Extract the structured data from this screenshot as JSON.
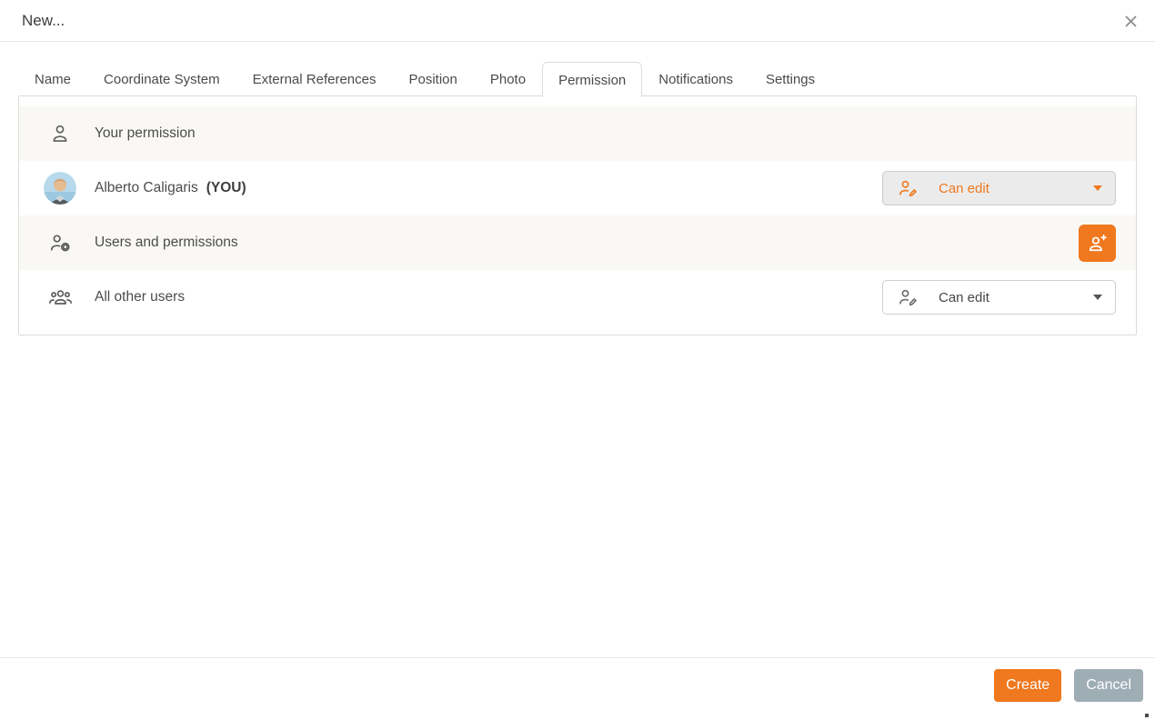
{
  "window": {
    "title": "New...",
    "close_icon": "x-icon"
  },
  "tabs": [
    {
      "label": "Name"
    },
    {
      "label": "Coordinate System"
    },
    {
      "label": "External References"
    },
    {
      "label": "Position"
    },
    {
      "label": "Photo"
    },
    {
      "label": "Permission",
      "active": true
    },
    {
      "label": "Notifications"
    },
    {
      "label": "Settings"
    }
  ],
  "permission_panel": {
    "your_permission_header": {
      "label": "Your permission",
      "icon": "person-icon"
    },
    "current_user": {
      "name": "Alberto Caligaris",
      "you_tag": "(YOU)",
      "avatar": "user-photo-avatar",
      "permission": {
        "label": "Can edit",
        "icon": "edit-user-icon",
        "state": "selected"
      }
    },
    "users_permissions_header": {
      "label": "Users and permissions",
      "icon": "users-gear-icon",
      "action_icon": "add-user-icon"
    },
    "all_other_users": {
      "label": "All other users",
      "icon": "group-icon",
      "permission": {
        "label": "Can edit",
        "icon": "edit-user-icon",
        "state": "default"
      }
    }
  },
  "footer": {
    "create_label": "Create",
    "cancel_label": "Cancel"
  },
  "colors": {
    "accent_orange": "#F0781E",
    "cancel_gray": "#9FADB5",
    "row_alt_background": "#F9F8F5",
    "panel_border": "#DDDCD8",
    "text_dark": "#4C4C4C"
  }
}
